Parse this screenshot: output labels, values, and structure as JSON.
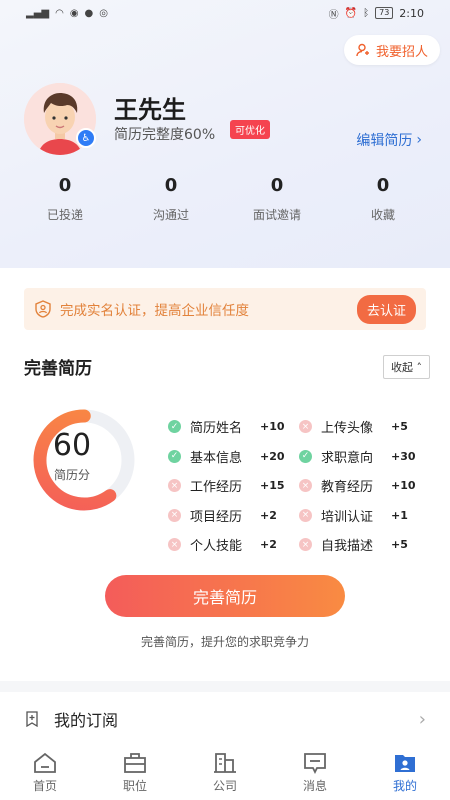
{
  "status_bar": {
    "time": "2:10",
    "battery": "73"
  },
  "header": {
    "recruit_label": "我要招人"
  },
  "profile": {
    "name": "王先生",
    "completeness": "简历完整度60%",
    "optimize_badge": "可优化",
    "edit_label": "编辑简历"
  },
  "stats": [
    {
      "value": "0",
      "label": "已投递"
    },
    {
      "value": "0",
      "label": "沟通过"
    },
    {
      "value": "0",
      "label": "面试邀请"
    },
    {
      "value": "0",
      "label": "收藏"
    }
  ],
  "notice": {
    "text": "完成实名认证，提高企业信任度",
    "button": "去认证"
  },
  "resume": {
    "title": "完善简历",
    "collapse_label": "收起",
    "score": "60",
    "score_label": "简历分",
    "score_fraction": 0.6,
    "items": [
      {
        "name": "简历姓名",
        "points": "+10",
        "done": true
      },
      {
        "name": "上传头像",
        "points": "+5",
        "done": false
      },
      {
        "name": "基本信息",
        "points": "+20",
        "done": true
      },
      {
        "name": "求职意向",
        "points": "+30",
        "done": true
      },
      {
        "name": "工作经历",
        "points": "+15",
        "done": false
      },
      {
        "name": "教育经历",
        "points": "+10",
        "done": false
      },
      {
        "name": "项目经历",
        "points": "+2",
        "done": false
      },
      {
        "name": "培训认证",
        "points": "+1",
        "done": false
      },
      {
        "name": "个人技能",
        "points": "+2",
        "done": false
      },
      {
        "name": "自我描述",
        "points": "+5",
        "done": false
      }
    ],
    "button": "完善简历",
    "hint": "完善简历，提升您的求职竞争力"
  },
  "subscription": {
    "label": "我的订阅"
  },
  "tabs": [
    {
      "label": "首页",
      "icon": "home-icon",
      "active": false
    },
    {
      "label": "职位",
      "icon": "briefcase-icon",
      "active": false
    },
    {
      "label": "公司",
      "icon": "building-icon",
      "active": false
    },
    {
      "label": "消息",
      "icon": "message-icon",
      "active": false
    },
    {
      "label": "我的",
      "icon": "profile-icon",
      "active": true
    }
  ],
  "colors": {
    "accent": "#2f6fd3",
    "brand_orange": "#f26b43",
    "danger": "#f5434f"
  }
}
